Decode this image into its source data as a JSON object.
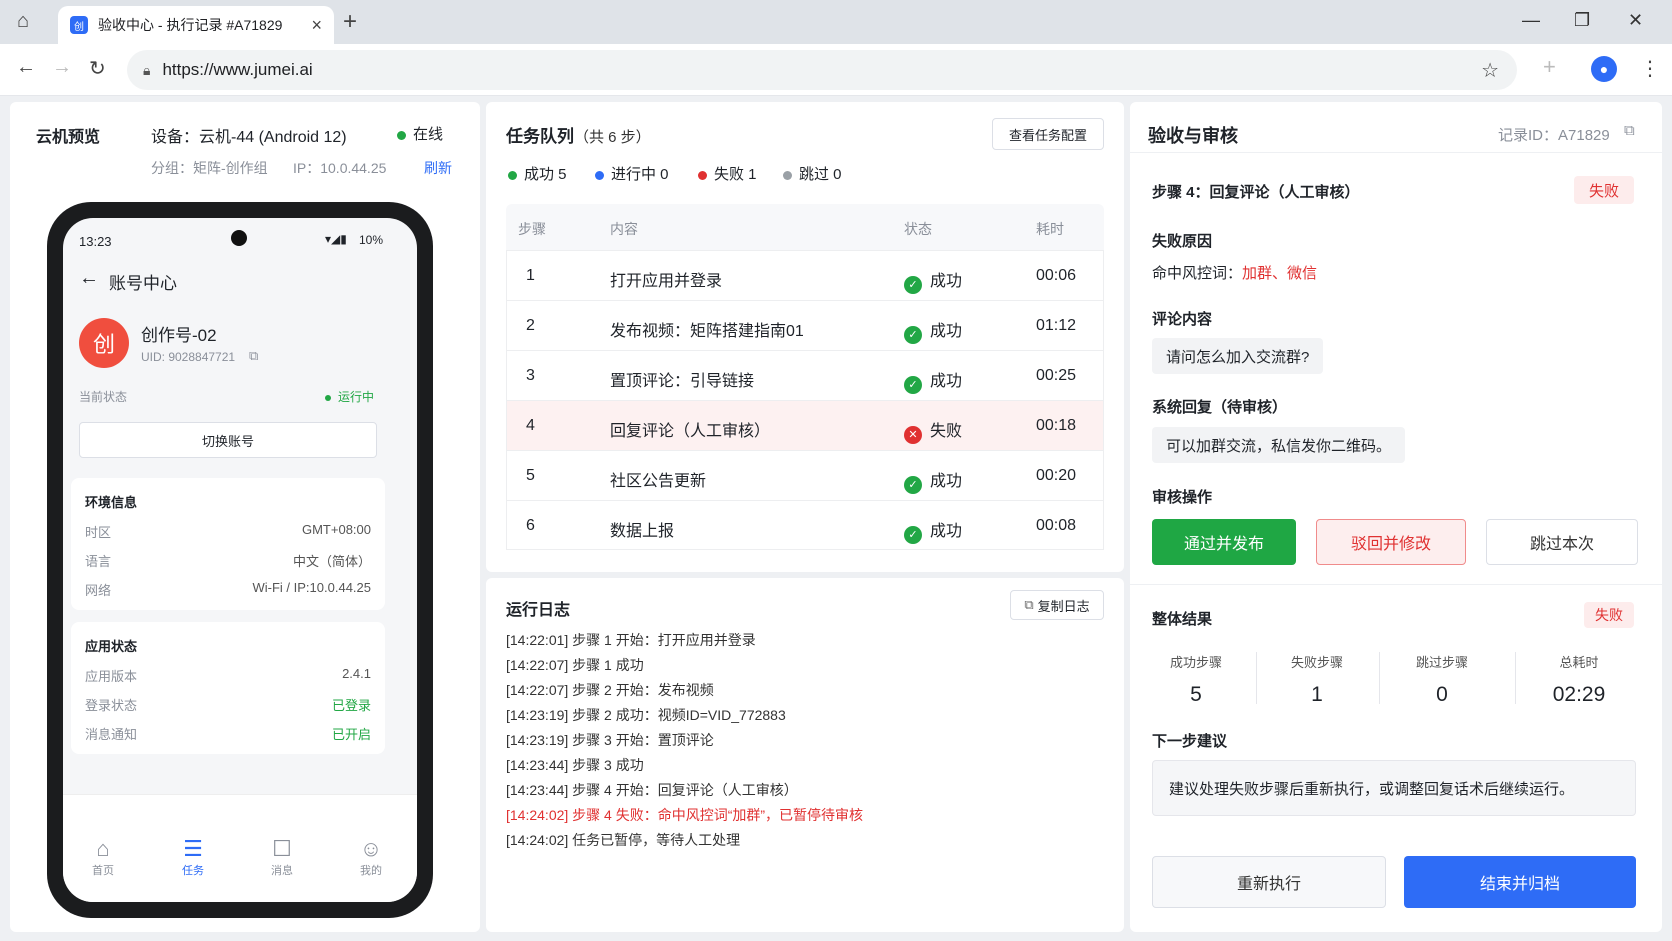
{
  "browser": {
    "tab_title": "验收中心 - 执行记录 #A71829",
    "favicon": "创",
    "url": "https://www.jumei.ai"
  },
  "device_panel": {
    "title": "云机预览",
    "device_label": "设备：云机-44 (Android 12)",
    "online": "在线",
    "group": "分组：矩阵-创作组",
    "ip": "IP：10.0.44.25",
    "refresh": "刷新",
    "phone": {
      "time": "13:23",
      "battery": "10%",
      "header": "账号中心",
      "avatar_char": "创",
      "account_name": "创作号-02",
      "uid": "UID: 9028847721",
      "status_label": "当前状态",
      "status_value": "运行中",
      "switch_btn": "切换账号",
      "env_title": "环境信息",
      "env": [
        {
          "k": "时区",
          "v": "GMT+08:00"
        },
        {
          "k": "语言",
          "v": "中文（简体）"
        },
        {
          "k": "网络",
          "v": "Wi-Fi / IP:10.0.44.25"
        }
      ],
      "app_title": "应用状态",
      "app": [
        {
          "k": "应用版本",
          "v": "2.4.1"
        },
        {
          "k": "登录状态",
          "v": "已登录"
        },
        {
          "k": "消息通知",
          "v": "已开启"
        }
      ],
      "nav": [
        {
          "label": "首页"
        },
        {
          "label": "任务"
        },
        {
          "label": "消息"
        },
        {
          "label": "我的"
        }
      ]
    }
  },
  "queue": {
    "title": "任务队列",
    "count": "（共 6 步）",
    "config_btn": "查看任务配置",
    "summary": [
      {
        "label": "成功 5",
        "color": "#22a745"
      },
      {
        "label": "进行中 0",
        "color": "#2e6cf6"
      },
      {
        "label": "失败 1",
        "color": "#e03131"
      },
      {
        "label": "跳过 0",
        "color": "#9aa0a6"
      }
    ],
    "headers": [
      "步骤",
      "内容",
      "状态",
      "耗时"
    ],
    "rows": [
      {
        "step": "1",
        "content": "打开应用并登录",
        "status": "成功",
        "time": "00:06",
        "ok": true
      },
      {
        "step": "2",
        "content": "发布视频：矩阵搭建指南01",
        "status": "成功",
        "time": "01:12",
        "ok": true
      },
      {
        "step": "3",
        "content": "置顶评论：引导链接",
        "status": "成功",
        "time": "00:25",
        "ok": true
      },
      {
        "step": "4",
        "content": "回复评论（人工审核）",
        "status": "失败",
        "time": "00:18",
        "ok": false
      },
      {
        "step": "5",
        "content": "社区公告更新",
        "status": "成功",
        "time": "00:20",
        "ok": true
      },
      {
        "step": "6",
        "content": "数据上报",
        "status": "成功",
        "time": "00:08",
        "ok": true
      }
    ]
  },
  "log": {
    "title": "运行日志",
    "copy_btn": "复制日志",
    "lines": [
      {
        "text": "[14:22:01] 步骤 1 开始：打开应用并登录",
        "error": false
      },
      {
        "text": "[14:22:07] 步骤 1 成功",
        "error": false
      },
      {
        "text": "[14:22:07] 步骤 2 开始：发布视频",
        "error": false
      },
      {
        "text": "[14:23:19] 步骤 2 成功：视频ID=VID_772883",
        "error": false
      },
      {
        "text": "[14:23:19] 步骤 3 开始：置顶评论",
        "error": false
      },
      {
        "text": "[14:23:44] 步骤 3 成功",
        "error": false
      },
      {
        "text": "[14:23:44] 步骤 4 开始：回复评论（人工审核）",
        "error": false
      },
      {
        "text": "[14:24:02] 步骤 4 失败：命中风控词“加群”，已暂停待审核",
        "error": true
      },
      {
        "text": "[14:24:02] 任务已暂停，等待人工处理",
        "error": false
      }
    ]
  },
  "review": {
    "title": "验收与审核",
    "record_id": "记录ID：A71829",
    "step_title": "步骤 4：回复评论（人工审核）",
    "step_badge": "失败",
    "fail_reason_title": "失败原因",
    "fail_reason_prefix": "命中风控词：",
    "fail_words": "加群、微信",
    "comment_title": "评论内容",
    "comment": "请问怎么加入交流群?",
    "reply_title": "系统回复（待审核）",
    "reply": "可以加群交流，私信发你二维码。",
    "action_title": "审核操作",
    "approve_btn": "通过并发布",
    "reject_btn": "驳回并修改",
    "skip_btn": "跳过本次",
    "overall_title": "整体结果",
    "overall_badge": "失败",
    "stats": [
      {
        "label": "成功步骤",
        "value": "5"
      },
      {
        "label": "失败步骤",
        "value": "1"
      },
      {
        "label": "跳过步骤",
        "value": "0"
      },
      {
        "label": "总耗时",
        "value": "02:29"
      }
    ],
    "next_title": "下一步建议",
    "next_text": "建议处理失败步骤后重新执行，或调整回复话术后继续运行。",
    "rerun_btn": "重新执行",
    "finish_btn": "结束并归档"
  },
  "colors": {
    "primary": "#2e6cf6",
    "success": "#22a745",
    "danger": "#e03131"
  }
}
